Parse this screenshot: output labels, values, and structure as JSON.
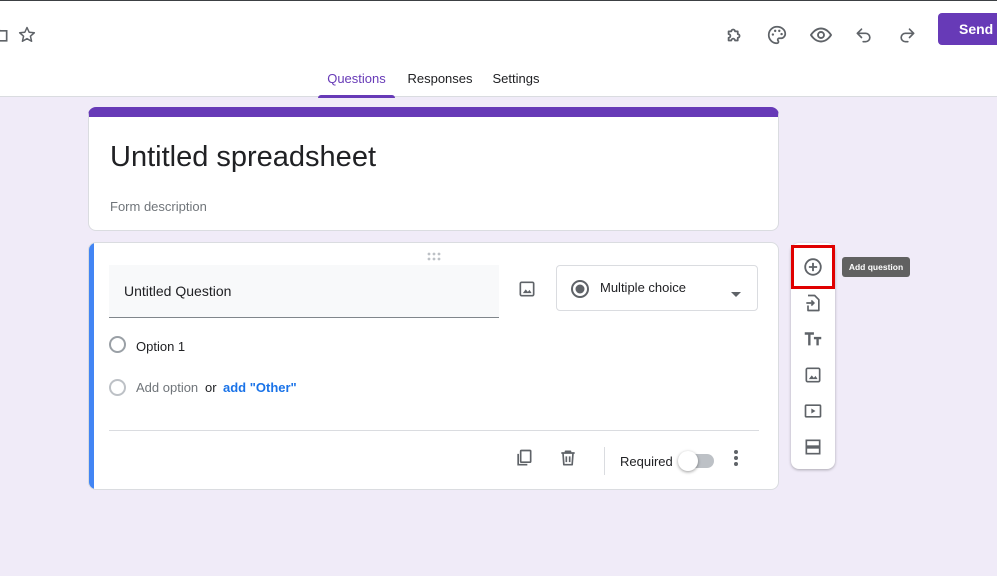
{
  "header": {
    "send_label": "Send",
    "icons": [
      "folder-icon",
      "star-icon",
      "addon-icon",
      "palette-icon",
      "eye-icon",
      "undo-icon",
      "redo-icon"
    ]
  },
  "tabs": [
    {
      "label": "Questions",
      "active": true
    },
    {
      "label": "Responses",
      "active": false
    },
    {
      "label": "Settings",
      "active": false
    }
  ],
  "form": {
    "title": "Untitled spreadsheet",
    "description_placeholder": "Form description"
  },
  "question": {
    "title": "Untitled Question",
    "type": "Multiple choice",
    "options": [
      "Option 1"
    ],
    "add_option": "Add option",
    "or": "or",
    "add_other": "add \"Other\"",
    "required_label": "Required",
    "required": false
  },
  "toolbar": {
    "tooltip": "Add question",
    "items": [
      "add-question",
      "import-questions",
      "add-title",
      "add-image",
      "add-video",
      "add-section"
    ]
  },
  "colors": {
    "accent": "#673ab7",
    "background": "#f0ebf8",
    "question_bar": "#4285f4",
    "link": "#1a73e8",
    "highlight": "#e00000"
  }
}
